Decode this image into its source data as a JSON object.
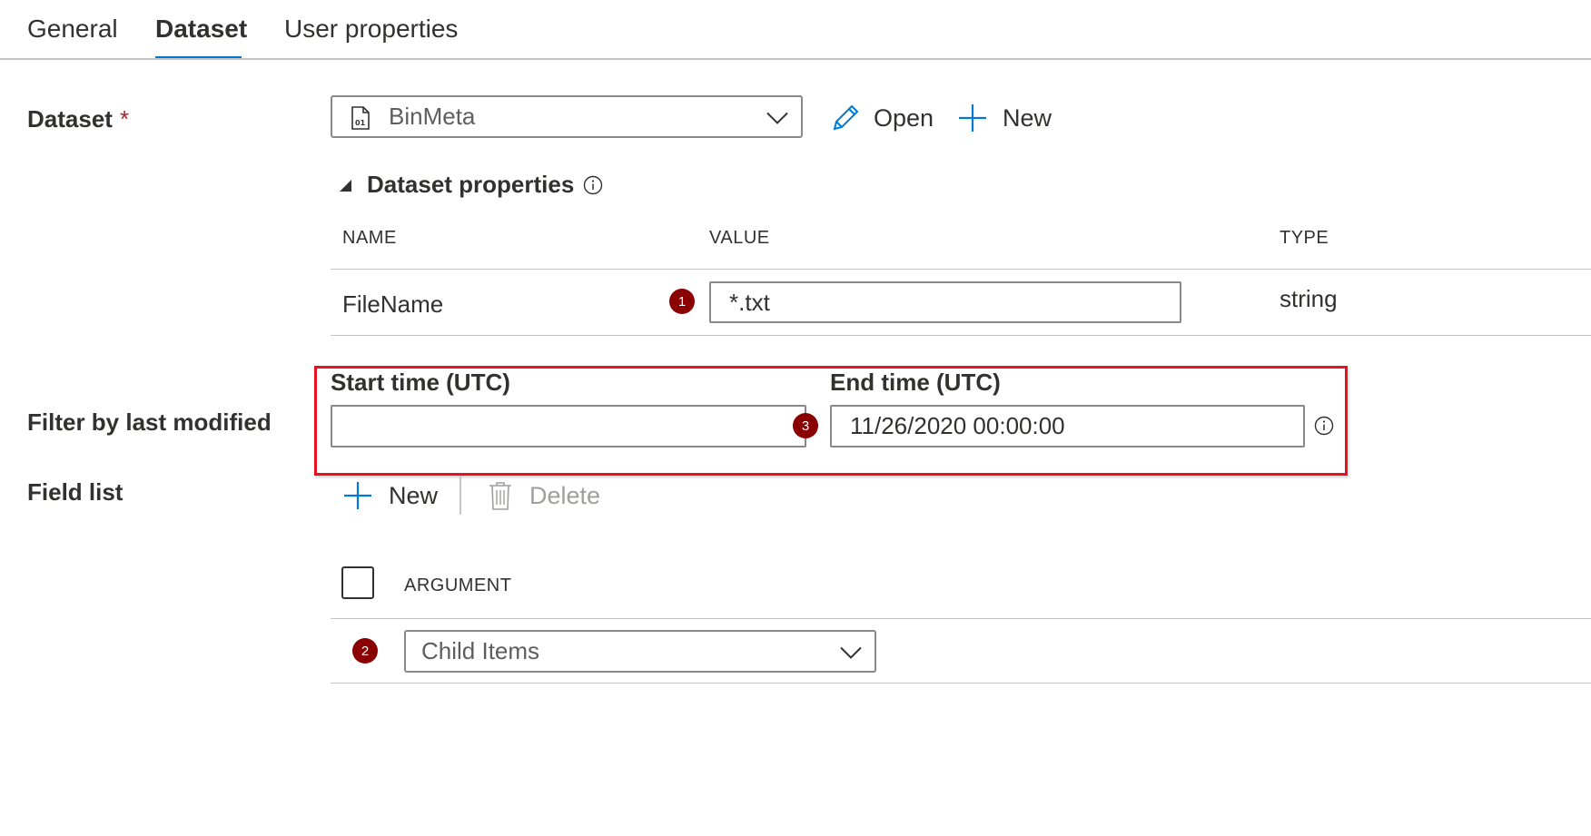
{
  "tabs": [
    {
      "label": "General",
      "active": false
    },
    {
      "label": "Dataset",
      "active": true
    },
    {
      "label": "User properties",
      "active": false
    }
  ],
  "dataset": {
    "label": "Dataset",
    "required_mark": "*",
    "selected": "BinMeta",
    "icon": "dataset-file-icon",
    "open_label": "Open",
    "new_label": "New"
  },
  "dataset_properties": {
    "title": "Dataset properties",
    "columns": {
      "name": "NAME",
      "value": "VALUE",
      "type": "TYPE"
    },
    "rows": [
      {
        "name": "FileName",
        "value": "*.txt",
        "type": "string"
      }
    ]
  },
  "filter": {
    "label": "Filter by last modified",
    "start_label": "Start time (UTC)",
    "start_value": "",
    "end_label": "End time (UTC)",
    "end_value": "11/26/2020 00:00:00"
  },
  "field_list": {
    "label": "Field list",
    "new_label": "New",
    "delete_label": "Delete",
    "column_argument": "ARGUMENT",
    "rows": [
      {
        "argument": "Child Items"
      }
    ]
  },
  "markers": [
    "1",
    "2",
    "3"
  ],
  "colors": {
    "accent": "#0078d4",
    "required": "#a4262c",
    "marker": "#8b0000",
    "highlight_border": "#e81123",
    "disabled": "#a19f9d"
  }
}
